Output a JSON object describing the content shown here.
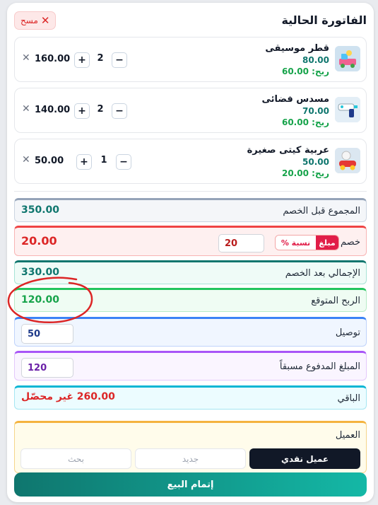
{
  "header": {
    "title": "الفاتورة الحالية",
    "clear_label": "مسح"
  },
  "items": [
    {
      "name": "قطر موسيقى",
      "price": "80.00",
      "profit": "ربح: 60.00",
      "qty": "2",
      "total": "160.00"
    },
    {
      "name": "مسدس فضائى",
      "price": "70.00",
      "profit": "ربح: 60.00",
      "qty": "2",
      "total": "140.00"
    },
    {
      "name": "عربية كيتى صغيرة",
      "price": "50.00",
      "profit": "ربح: 20.00",
      "qty": "1",
      "total": "50.00"
    }
  ],
  "summary": {
    "subtotal_label": "المجموع قبل الخصم",
    "subtotal_value": "350.00",
    "discount_label": "خصم",
    "discount_toggle_amount": "مبلغ",
    "discount_toggle_percent": "نسبة %",
    "discount_input": "20",
    "discount_value": "20.00",
    "after_discount_label": "الإجمالي بعد الخصم",
    "after_discount_value": "330.00",
    "profit_label": "الربح المتوقع",
    "profit_value": "120.00",
    "delivery_label": "توصيل",
    "delivery_value": "50",
    "prepaid_label": "المبلغ المدفوع مسبقاً",
    "prepaid_value": "120",
    "remaining_label": "الباقي",
    "remaining_value": "260.00 غير محصّل"
  },
  "customer": {
    "label": "العميل",
    "options": [
      "عميل نقدي",
      "جديد",
      "بحث"
    ],
    "selected": "عميل نقدي"
  },
  "actions": {
    "complete_label": "إتمام البيع"
  },
  "colors": {
    "subtotal": "#94a3b8",
    "discount": "#ef4444",
    "after_discount": "#0f766e",
    "profit": "#22c55e",
    "delivery": "#3b82f6",
    "prepaid": "#a855f7",
    "remaining": "#06b6d4",
    "customer": "#f4b33f",
    "annotation": "#dc2626"
  }
}
